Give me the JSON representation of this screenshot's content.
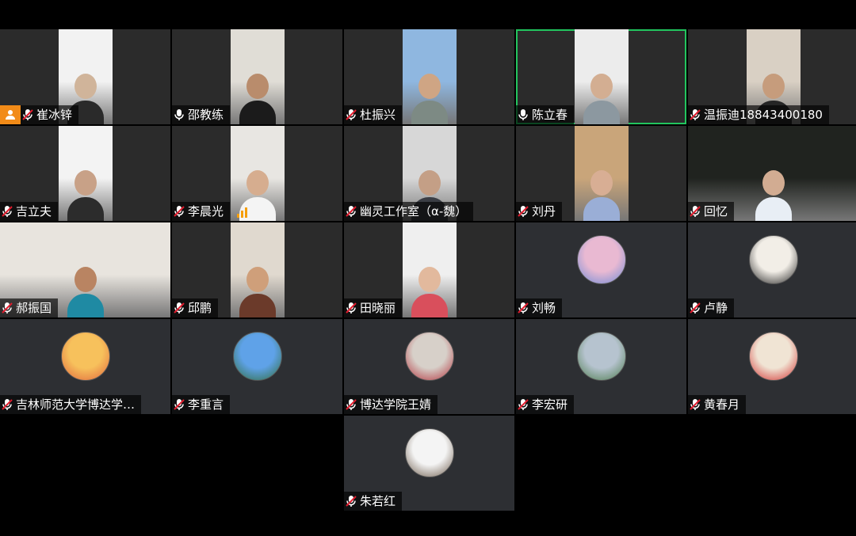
{
  "participants": [
    {
      "name": "崔冰锌",
      "mic": "muted",
      "type": "video",
      "host": true,
      "colors": [
        "#f2f2f2",
        "#d0b49a",
        "#2a2a2a"
      ]
    },
    {
      "name": "邵教练",
      "mic": "on",
      "type": "video",
      "colors": [
        "#e0ddd6",
        "#b98c6c",
        "#1b1b1b"
      ]
    },
    {
      "name": "杜振兴",
      "mic": "muted",
      "type": "video",
      "colors": [
        "#8fb7e0",
        "#cfa584",
        "#7d8a84"
      ]
    },
    {
      "name": "陈立春",
      "mic": "on",
      "type": "video",
      "active": true,
      "colors": [
        "#ececec",
        "#d3ae92",
        "#8c98a0"
      ]
    },
    {
      "name": "温振迪18843400180",
      "mic": "muted",
      "type": "video",
      "colors": [
        "#d9d0c4",
        "#c69c7c",
        "#252525"
      ]
    },
    {
      "name": "吉立夫",
      "mic": "muted",
      "type": "video",
      "colors": [
        "#f3f3f3",
        "#c8a187",
        "#2c2c2c"
      ]
    },
    {
      "name": "李晨光",
      "mic": "muted",
      "type": "video",
      "signal": true,
      "colors": [
        "#e8e6e2",
        "#d6ad8f",
        "#f4f4f4"
      ]
    },
    {
      "name": "幽灵工作室（α-魏）",
      "mic": "muted",
      "type": "video",
      "colors": [
        "#d7d7d7",
        "#c49f86",
        "#3a3d44"
      ]
    },
    {
      "name": "刘丹",
      "mic": "muted",
      "type": "video",
      "colors": [
        "#c9a57a",
        "#d8ae94",
        "#9aaed6"
      ]
    },
    {
      "name": "回忆",
      "mic": "muted",
      "type": "video",
      "wide": true,
      "colors": [
        "#20231f",
        "#d2ac92",
        "#e8eef5"
      ]
    },
    {
      "name": "郝振国",
      "mic": "muted",
      "type": "video",
      "wide": true,
      "colors": [
        "#e8e4de",
        "#b98462",
        "#1f8aa3"
      ]
    },
    {
      "name": "邱鹏",
      "mic": "muted",
      "type": "video",
      "colors": [
        "#e0d9cf",
        "#cf9f7a",
        "#6b3a2a"
      ]
    },
    {
      "name": "田晓丽",
      "mic": "muted",
      "type": "video",
      "colors": [
        "#efefef",
        "#e2b99d",
        "#d94f5c"
      ]
    },
    {
      "name": "刘畅",
      "mic": "muted",
      "type": "audio",
      "avatar_colors": [
        "#e9b9d2",
        "#6c8ad6"
      ]
    },
    {
      "name": "卢静",
      "mic": "muted",
      "type": "audio",
      "avatar_colors": [
        "#f2eee7",
        "#222222"
      ]
    },
    {
      "name": "吉林师范大学博达学…",
      "mic": "muted",
      "type": "audio",
      "avatar_colors": [
        "#f7c15c",
        "#e0643c"
      ]
    },
    {
      "name": "李重言",
      "mic": "muted",
      "type": "audio",
      "avatar_colors": [
        "#5fa2e8",
        "#2f6b3a"
      ]
    },
    {
      "name": "博达学院王婧",
      "mic": "muted",
      "type": "audio",
      "avatar_colors": [
        "#d7d0c9",
        "#b2303a"
      ]
    },
    {
      "name": "李宏研",
      "mic": "muted",
      "type": "audio",
      "avatar_colors": [
        "#b6c3cf",
        "#4a7a4a"
      ]
    },
    {
      "name": "黄春月",
      "mic": "muted",
      "type": "audio",
      "avatar_colors": [
        "#f0e4d4",
        "#d22d2d"
      ]
    },
    {
      "name": "朱若红",
      "mic": "muted",
      "type": "audio",
      "avatar_colors": [
        "#f4f4f4",
        "#6b5a4a"
      ]
    }
  ],
  "colors": {
    "background": "#000000",
    "tile": "#2b2b2b",
    "active_border": "#22c55e",
    "host_badge": "#f28b18",
    "muted_red": "#e11d2e"
  },
  "icons": {
    "muted": "mic-muted-icon",
    "on": "mic-icon",
    "host": "host-icon",
    "signal": "signal-bars-icon"
  }
}
